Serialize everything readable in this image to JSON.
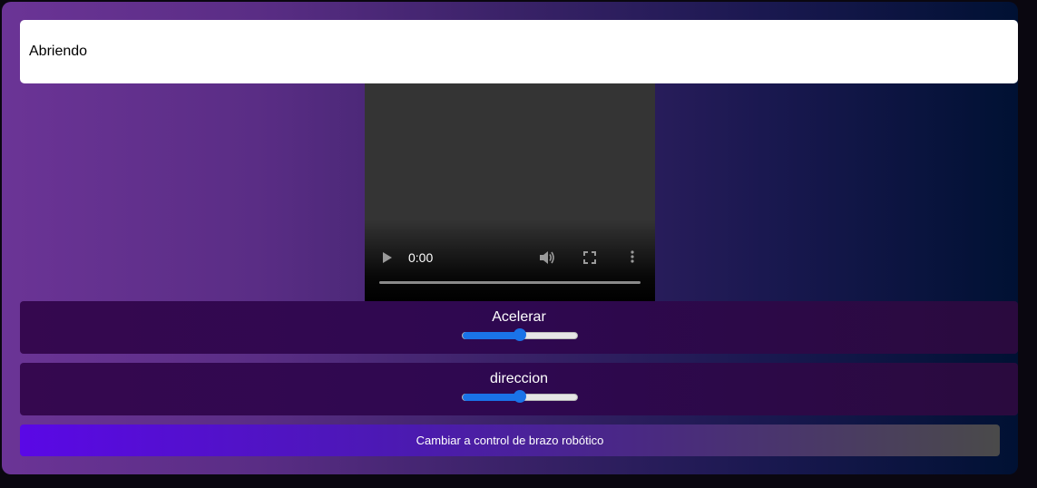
{
  "status": {
    "text": "Abriendo"
  },
  "video": {
    "time": "0:00",
    "progress": 0,
    "icons": {
      "play": "play-icon",
      "volume": "volume-icon",
      "fullscreen": "fullscreen-icon",
      "more": "more-options-icon"
    }
  },
  "controls": {
    "accelerate": {
      "label": "Acelerar",
      "value": 0.5
    },
    "direction": {
      "label": "direccion",
      "value": 0.5
    }
  },
  "switch_button": {
    "label": "Cambiar a control de brazo robótico"
  },
  "colors": {
    "accent": "#1a73e8",
    "button_start": "#5a08e6"
  }
}
